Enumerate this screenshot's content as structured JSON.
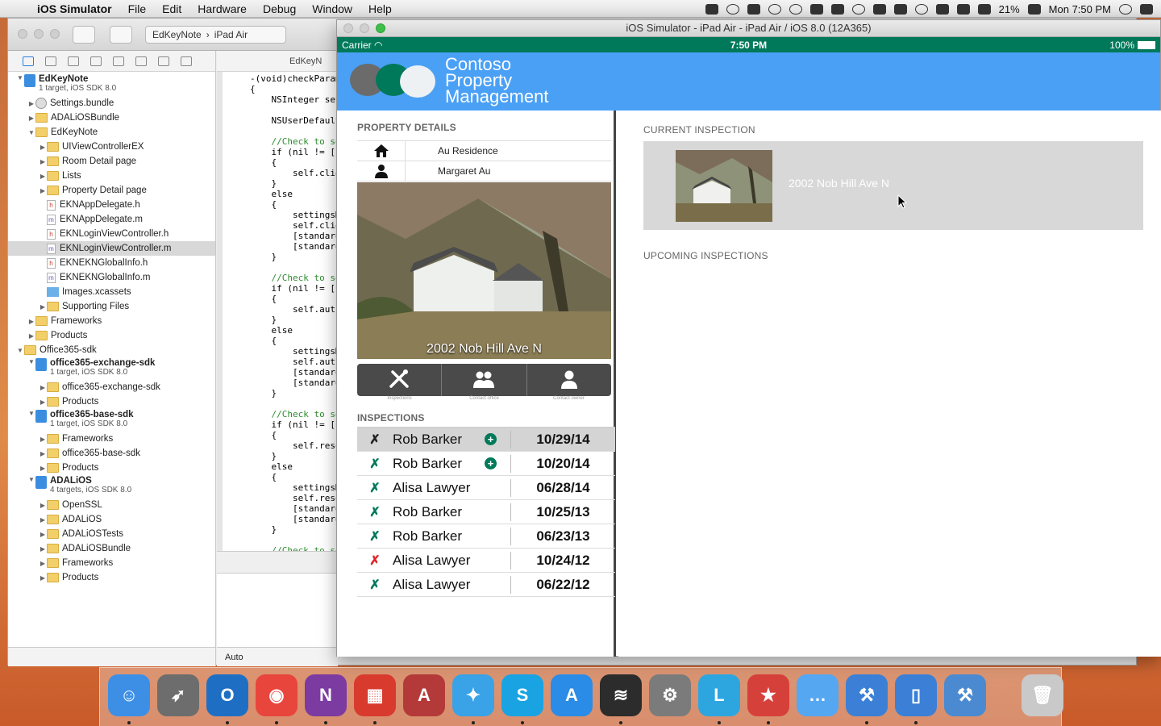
{
  "menubar": {
    "app": "iOS Simulator",
    "items": [
      "File",
      "Edit",
      "Hardware",
      "Debug",
      "Window",
      "Help"
    ],
    "battery": "21%",
    "clock": "Mon 7:50 PM"
  },
  "xcode": {
    "scheme": "EdKeyNote",
    "device": "iPad Air",
    "editor_tab": "EdKeyN",
    "auto": "Auto"
  },
  "navigator": [
    {
      "label": "EdKeyNote",
      "sub": "1 target, iOS SDK 8.0",
      "type": "proj",
      "depth": 0,
      "open": true,
      "bold": true
    },
    {
      "label": "Settings.bundle",
      "type": "bundle",
      "depth": 1
    },
    {
      "label": "ADALiOSBundle",
      "type": "folder",
      "depth": 1
    },
    {
      "label": "EdKeyNote",
      "type": "folder",
      "depth": 1,
      "open": true
    },
    {
      "label": "UIViewControllerEX",
      "type": "folder",
      "depth": 2
    },
    {
      "label": "Room Detail page",
      "type": "folder",
      "depth": 2
    },
    {
      "label": "Lists",
      "type": "folder",
      "depth": 2
    },
    {
      "label": "Property Detail page",
      "type": "folder",
      "depth": 2
    },
    {
      "label": "EKNAppDelegate.h",
      "type": "h",
      "depth": 2
    },
    {
      "label": "EKNAppDelegate.m",
      "type": "m",
      "depth": 2
    },
    {
      "label": "EKNLoginViewController.h",
      "type": "h",
      "depth": 2
    },
    {
      "label": "EKNLoginViewController.m",
      "type": "m",
      "depth": 2,
      "selected": true
    },
    {
      "label": "EKNEKNGlobalInfo.h",
      "type": "h",
      "depth": 2
    },
    {
      "label": "EKNEKNGlobalInfo.m",
      "type": "m",
      "depth": 2
    },
    {
      "label": "Images.xcassets",
      "type": "asset",
      "depth": 2
    },
    {
      "label": "Supporting Files",
      "type": "folder",
      "depth": 2
    },
    {
      "label": "Frameworks",
      "type": "folder",
      "depth": 1
    },
    {
      "label": "Products",
      "type": "folder",
      "depth": 1
    },
    {
      "label": "Office365-sdk",
      "type": "folder",
      "depth": 0,
      "open": true
    },
    {
      "label": "office365-exchange-sdk",
      "sub": "1 target, iOS SDK 8.0",
      "type": "proj",
      "depth": 1,
      "open": true,
      "bold": true
    },
    {
      "label": "office365-exchange-sdk",
      "type": "folder",
      "depth": 2
    },
    {
      "label": "Products",
      "type": "folder",
      "depth": 2
    },
    {
      "label": "office365-base-sdk",
      "sub": "1 target, iOS SDK 8.0",
      "type": "proj",
      "depth": 1,
      "open": true,
      "bold": true
    },
    {
      "label": "Frameworks",
      "type": "folder",
      "depth": 2
    },
    {
      "label": "office365-base-sdk",
      "type": "folder",
      "depth": 2
    },
    {
      "label": "Products",
      "type": "folder",
      "depth": 2
    },
    {
      "label": "ADALiOS",
      "sub": "4 targets, iOS SDK 8.0",
      "type": "proj",
      "depth": 1,
      "open": true,
      "bold": true
    },
    {
      "label": "OpenSSL",
      "type": "folder",
      "depth": 2
    },
    {
      "label": "ADALiOS",
      "type": "folder",
      "depth": 2
    },
    {
      "label": "ADALiOSTests",
      "type": "folder",
      "depth": 2
    },
    {
      "label": "ADALiOSBundle",
      "type": "folder",
      "depth": 2
    },
    {
      "label": "Frameworks",
      "type": "folder",
      "depth": 2
    },
    {
      "label": "Products",
      "type": "folder",
      "depth": 2
    }
  ],
  "code": [
    "-(void)checkParame",
    "{",
    "    NSInteger sett",
    "",
    "    NSUserDefaults",
    "",
    "    //Check to see",
    "    if (nil != [st",
    "    {",
    "        self.clien",
    "    }",
    "    else",
    "    {",
    "        settingsMi",
    "        self.clien",
    "        [standardU",
    "        [standardU",
    "    }",
    "",
    "    //Check to see",
    "    if (nil != [st",
    "    {",
    "        self.autho",
    "    }",
    "    else",
    "    {",
    "        settingsMi",
    "        self.autho",
    "        [standardU",
    "        [standardU",
    "    }",
    "",
    "    //Check to see",
    "    if (nil != [st",
    "    {",
    "        self.resou",
    "    }",
    "    else",
    "    {",
    "        settingsMi",
    "        self.resou",
    "        [standardU",
    "        [standardU",
    "    }",
    "",
    "    //Check to see"
  ],
  "simulator": {
    "title": "iOS Simulator - iPad Air - iPad Air / iOS 8.0 (12A365)",
    "carrier": "Carrier",
    "time": "7:50 PM",
    "battery": "100%"
  },
  "app": {
    "brand": [
      "Contoso",
      "Property",
      "Management"
    ],
    "property_details_title": "PROPERTY DETAILS",
    "residence": "Au Residence",
    "owner": "Margaret Au",
    "address": "2002 Nob Hill Ave N",
    "actions": [
      "Inspections",
      "Contact office",
      "Contact owner"
    ],
    "inspections_title": "INSPECTIONS",
    "inspections": [
      {
        "name": "Rob Barker",
        "date": "10/29/14",
        "status": "dark",
        "plus": true,
        "selected": true
      },
      {
        "name": "Rob Barker",
        "date": "10/20/14",
        "status": "green",
        "plus": true
      },
      {
        "name": "Alisa Lawyer",
        "date": "06/28/14",
        "status": "green"
      },
      {
        "name": "Rob Barker",
        "date": "10/25/13",
        "status": "green"
      },
      {
        "name": "Rob Barker",
        "date": "06/23/13",
        "status": "green"
      },
      {
        "name": "Alisa Lawyer",
        "date": "10/24/12",
        "status": "red"
      },
      {
        "name": "Alisa Lawyer",
        "date": "06/22/12",
        "status": "green"
      }
    ],
    "current_title": "CURRENT INSPECTION",
    "current_address": "2002 Nob Hill Ave N",
    "upcoming_title": "UPCOMING INSPECTIONS"
  },
  "colors": {
    "brand_blue": "#4aa0f5",
    "brand_green": "#00795a",
    "status_red": "#e0242a"
  },
  "dock": [
    {
      "name": "finder-icon",
      "color": "#3d8fe6",
      "glyph": "☺",
      "running": true
    },
    {
      "name": "launchpad-icon",
      "color": "#6d6d6d",
      "glyph": "➶"
    },
    {
      "name": "outlook-icon",
      "color": "#1e6fc4",
      "glyph": "O",
      "running": true
    },
    {
      "name": "chrome-icon",
      "color": "#e8453c",
      "glyph": "◉",
      "running": true
    },
    {
      "name": "onenote-icon",
      "color": "#7b3ba1",
      "glyph": "N",
      "running": true
    },
    {
      "name": "parallels-icon",
      "color": "#d93a2e",
      "glyph": "▦",
      "running": true
    },
    {
      "name": "pdf-reader-icon",
      "color": "#b43a3a",
      "glyph": "A"
    },
    {
      "name": "twitter-icon",
      "color": "#3aa2e6",
      "glyph": "✦",
      "running": true
    },
    {
      "name": "skype-icon",
      "color": "#1aa3e3",
      "glyph": "S",
      "running": true
    },
    {
      "name": "app-store-icon",
      "color": "#2a8ce6",
      "glyph": "A"
    },
    {
      "name": "spotify-icon",
      "color": "#2c2c2c",
      "glyph": "≋",
      "running": true
    },
    {
      "name": "system-preferences-icon",
      "color": "#7b7b7b",
      "glyph": "⚙"
    },
    {
      "name": "lync-icon",
      "color": "#2da6e0",
      "glyph": "L",
      "running": true
    },
    {
      "name": "todoist-icon",
      "color": "#d6403a",
      "glyph": "★",
      "running": true
    },
    {
      "name": "messages-icon",
      "color": "#55a7f2",
      "glyph": "…"
    },
    {
      "name": "xcode-icon",
      "color": "#3b80d6",
      "glyph": "⚒",
      "running": true
    },
    {
      "name": "ios-simulator-icon",
      "color": "#3b80d6",
      "glyph": "▯",
      "running": true
    },
    {
      "name": "instruments-icon",
      "color": "#4b8ad0",
      "glyph": "⚒"
    },
    {
      "name": "trash-icon",
      "color": "#c9c9c9",
      "glyph": "🗑"
    }
  ]
}
